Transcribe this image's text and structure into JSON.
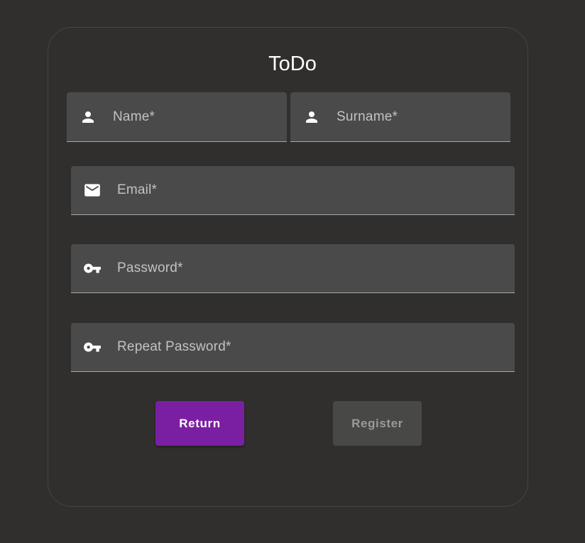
{
  "app": {
    "title": "ToDo"
  },
  "form": {
    "name": {
      "label": "Name*",
      "value": "",
      "icon": "person-icon"
    },
    "surname": {
      "label": "Surname*",
      "value": "",
      "icon": "person-icon"
    },
    "email": {
      "label": "Email*",
      "value": "",
      "icon": "mail-icon"
    },
    "password": {
      "label": "Password*",
      "value": "",
      "icon": "key-icon"
    },
    "repeat_password": {
      "label": "Repeat Password*",
      "value": "",
      "icon": "key-icon"
    }
  },
  "actions": {
    "return_label": "Return",
    "register_label": "Register",
    "register_disabled": true
  },
  "colors": {
    "background": "#302f2d",
    "card_border": "#454442",
    "field_background": "#4a4a4a",
    "accent": "#7b1fa2",
    "disabled_button": "#484847",
    "disabled_text": "#9a9a9a"
  }
}
